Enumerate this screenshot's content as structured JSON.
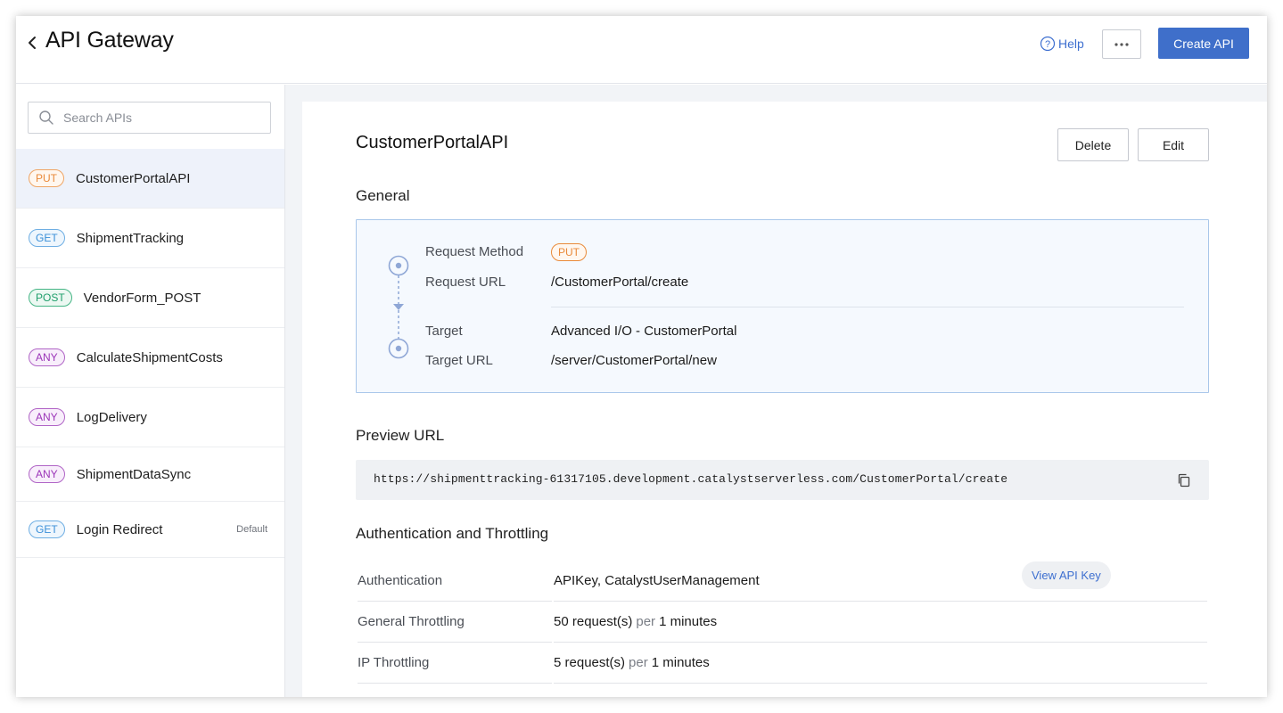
{
  "header": {
    "title": "API Gateway",
    "help_label": "Help",
    "create_label": "Create API"
  },
  "sidebar": {
    "search_placeholder": "Search APIs",
    "items": [
      {
        "method": "PUT",
        "name": "CustomerPortalAPI",
        "default": ""
      },
      {
        "method": "GET",
        "name": "ShipmentTracking",
        "default": ""
      },
      {
        "method": "POST",
        "name": "VendorForm_POST",
        "default": ""
      },
      {
        "method": "ANY",
        "name": "CalculateShipmentCosts",
        "default": ""
      },
      {
        "method": "ANY",
        "name": "LogDelivery",
        "default": ""
      },
      {
        "method": "ANY",
        "name": "ShipmentDataSync",
        "default": ""
      },
      {
        "method": "GET",
        "name": "Login Redirect",
        "default": "Default"
      }
    ]
  },
  "detail": {
    "title": "CustomerPortalAPI",
    "delete_label": "Delete",
    "edit_label": "Edit",
    "general": {
      "heading": "General",
      "request_method_label": "Request Method",
      "request_method": "PUT",
      "request_url_label": "Request URL",
      "request_url": "/CustomerPortal/create",
      "target_label": "Target",
      "target": "Advanced I/O - CustomerPortal",
      "target_url_label": "Target URL",
      "target_url": "/server/CustomerPortal/new"
    },
    "preview": {
      "heading": "Preview URL",
      "url": "https://shipmenttracking-61317105.development.catalystserverless.com/CustomerPortal/create"
    },
    "auth": {
      "heading": "Authentication and Throttling",
      "authentication_label": "Authentication",
      "authentication_value": "APIKey, CatalystUserManagement",
      "view_key_label": "View API Key",
      "general_throttling_label": "General Throttling",
      "general_throttling_count": "50 request(s)",
      "general_throttling_per": "per",
      "general_throttling_interval": "1 minutes",
      "ip_throttling_label": "IP Throttling",
      "ip_throttling_count": "5 request(s)",
      "ip_throttling_per": "per",
      "ip_throttling_interval": "1 minutes"
    }
  },
  "colors": {
    "primary": "#3f6fca",
    "put": "#e98a3a",
    "get": "#3a8fd8",
    "post": "#1f9e6b",
    "any": "#9b35b8",
    "selected_row": "#eef2fa"
  },
  "icons": {
    "back": "chevron-left-icon",
    "help": "help-circle-icon",
    "more": "ellipsis-icon",
    "search": "search-icon",
    "copy": "copy-icon"
  }
}
